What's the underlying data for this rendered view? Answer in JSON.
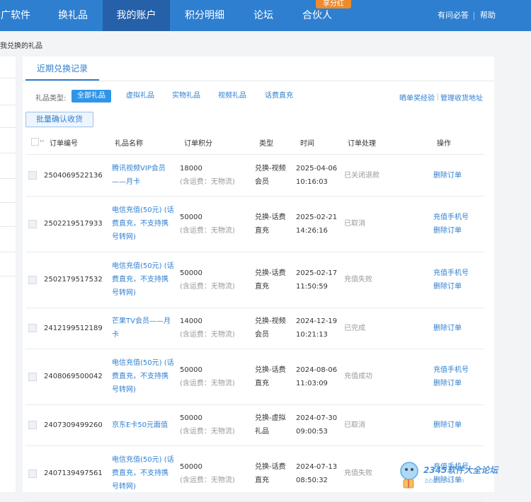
{
  "nav": {
    "items": [
      "广软件",
      "换礼品",
      "我的账户",
      "积分明细",
      "论坛",
      "合伙人"
    ],
    "badge": "享分红",
    "right_links": [
      "有问必答",
      "帮助"
    ]
  },
  "breadcrumb": "我兑换的礼品",
  "tab": "近期兑换记录",
  "filter": {
    "label": "礼品类型:",
    "options": [
      "全部礼品",
      "虚拟礼品",
      "实物礼品",
      "视频礼品",
      "话费直充"
    ],
    "selected": "全部礼品"
  },
  "top_links": [
    "晒单奖经验",
    "管理收货地址"
  ],
  "batch_button": "批量确认收货",
  "table": {
    "headers": [
      "订单编号",
      "礼品名称",
      "订单积分",
      "类型",
      "时间",
      "订单处理",
      "操作"
    ],
    "rows": [
      {
        "no": "2504069522136",
        "name": [
          "腾讯视频VIP会员",
          "——月卡"
        ],
        "points": "18000",
        "shipping": "(含运费：无物流)",
        "type": [
          "兑换-视频",
          "会员"
        ],
        "date": "2025-04-06",
        "time": "10:16:03",
        "status": "已关闭退款",
        "ops": [
          "删除订单"
        ]
      },
      {
        "no": "2502219517933",
        "name": [
          "电信充值(50元) (话",
          "费直充，不支持携",
          "号转网)"
        ],
        "points": "50000",
        "shipping": "(含运费：无物流)",
        "type": [
          "兑换-话费",
          "直充"
        ],
        "date": "2025-02-21",
        "time": "14:26:16",
        "status": "已取消",
        "ops": [
          "充值手机号",
          "删除订单"
        ]
      },
      {
        "no": "2502179517532",
        "name": [
          "电信充值(50元) (话",
          "费直充，不支持携",
          "号转网)"
        ],
        "points": "50000",
        "shipping": "(含运费：无物流)",
        "type": [
          "兑换-话费",
          "直充"
        ],
        "date": "2025-02-17",
        "time": "11:50:59",
        "status": "充值失败",
        "ops": [
          "充值手机号",
          "删除订单"
        ]
      },
      {
        "no": "2412199512189",
        "name": [
          "芒果TV会员——月",
          "卡"
        ],
        "points": "14000",
        "shipping": "(含运费：无物流)",
        "type": [
          "兑换-视频",
          "会员"
        ],
        "date": "2024-12-19",
        "time": "10:21:13",
        "status": "已完成",
        "ops": [
          "删除订单"
        ]
      },
      {
        "no": "2408069500042",
        "name": [
          "电信充值(50元) (话",
          "费直充，不支持携",
          "号转网)"
        ],
        "points": "50000",
        "shipping": "(含运费：无物流)",
        "type": [
          "兑换-话费",
          "直充"
        ],
        "date": "2024-08-06",
        "time": "11:03:09",
        "status": "充值成功",
        "ops": [
          "充值手机号",
          "删除订单"
        ]
      },
      {
        "no": "2407309499260",
        "name": [
          "京东E卡50元面值"
        ],
        "points": "50000",
        "shipping": "(含运费：无物流)",
        "type": [
          "兑换-虚拟",
          "礼品"
        ],
        "date": "2024-07-30",
        "time": "09:00:53",
        "status": "已取消",
        "ops": [
          "删除订单"
        ]
      },
      {
        "no": "2407139497561",
        "name": [
          "电信充值(50元) (话",
          "费直充，不支持携",
          "号转网)"
        ],
        "points": "50000",
        "shipping": "(含运费：无物流)",
        "type": [
          "兑换-话费",
          "直充"
        ],
        "date": "2024-07-13",
        "time": "08:50:32",
        "status": "充值失败",
        "ops": [
          "充值手机号",
          "删除订单"
        ]
      }
    ]
  },
  "watermark": {
    "title": "2345软件大全论坛",
    "sub": "bbs.2345.cn"
  }
}
